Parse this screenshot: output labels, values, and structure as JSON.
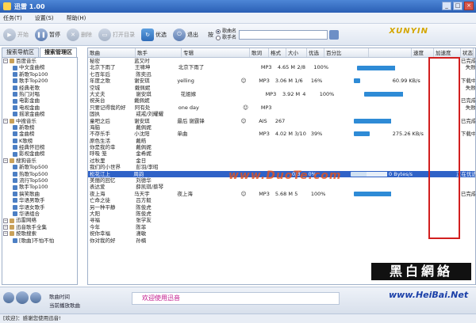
{
  "title_bar": {
    "title": "迅雷 1.00"
  },
  "menu": [
    "任务(T)",
    "设置(S)",
    "帮助(H)"
  ],
  "toolbar": {
    "buttons": [
      {
        "label": "开始",
        "enabled": false
      },
      {
        "label": "暂停",
        "enabled": true
      },
      {
        "label": "删除",
        "enabled": false
      },
      {
        "label": "打开目录",
        "enabled": false
      },
      {
        "label": "优选",
        "enabled": true
      },
      {
        "label": "退出",
        "enabled": true
      }
    ],
    "search_prefix": "按",
    "search_options": [
      "歌曲名",
      "歌手名"
    ],
    "search_value": "",
    "logo": "XUNYIN"
  },
  "tabs": [
    "搜索导航区",
    "搜索管理区"
  ],
  "tree": [
    {
      "label": "百度音乐",
      "level": 0
    },
    {
      "label": "中文金曲榜",
      "level": 1
    },
    {
      "label": "新歌Top100",
      "level": 1
    },
    {
      "label": "歌手Top200",
      "level": 1
    },
    {
      "label": "经典老歌",
      "level": 1
    },
    {
      "label": "热门对唱",
      "level": 1
    },
    {
      "label": "电影金曲",
      "level": 1
    },
    {
      "label": "电视金曲",
      "level": 1
    },
    {
      "label": "摇滚金曲榜",
      "level": 1
    },
    {
      "label": "中搜音乐",
      "level": 0
    },
    {
      "label": "新歌榜",
      "level": 1
    },
    {
      "label": "金曲榜",
      "level": 1
    },
    {
      "label": "K歌榜",
      "level": 1
    },
    {
      "label": "经典怀旧榜",
      "level": 1
    },
    {
      "label": "影视金曲榜",
      "level": 1
    },
    {
      "label": "搜狗音乐",
      "level": 0
    },
    {
      "label": "新歌Top500",
      "level": 1
    },
    {
      "label": "热歌Top500",
      "level": 1
    },
    {
      "label": "流行Top500",
      "level": 1
    },
    {
      "label": "歌手Top100",
      "level": 1
    },
    {
      "label": "搞笑歌曲",
      "level": 1
    },
    {
      "label": "华语男歌手",
      "level": 1
    },
    {
      "label": "华语女歌手",
      "level": 1
    },
    {
      "label": "华语组合",
      "level": 1
    },
    {
      "label": "迅雷网络",
      "level": 0
    },
    {
      "label": "迅音歌手全集",
      "level": 0
    },
    {
      "label": "按歌搜索",
      "level": 0
    },
    {
      "label": "[歌曲]不怕不怕",
      "level": 1
    }
  ],
  "list": {
    "columns": [
      "歌曲",
      "歌手",
      "专辑",
      "歌词",
      "格式",
      "大小",
      "优选",
      "百分比",
      "",
      "速度",
      "加速度",
      "状态"
    ],
    "rows": [
      {
        "song": "秘密",
        "artist": "蓝又时",
        "album": "",
        "lyric": "",
        "fmt": "",
        "size": "",
        "pick": "",
        "pct": "",
        "bar": 0,
        "speed": "",
        "accel": "",
        "status": "已完成"
      },
      {
        "song": "北京下雨了",
        "artist": "王啸坤",
        "album": "北京下雨了",
        "lyric": "",
        "fmt": "MP3",
        "size": "4.65 M",
        "pick": "2/8",
        "pct": "100%",
        "bar": 100,
        "speed": "",
        "accel": "",
        "status": "失败"
      },
      {
        "song": "七百年后",
        "artist": "陈奕迅",
        "album": "",
        "lyric": "",
        "fmt": "",
        "size": "",
        "pick": "",
        "pct": "",
        "bar": 0,
        "speed": "",
        "accel": "",
        "status": ""
      },
      {
        "song": "年度之歌",
        "artist": "谢安琪",
        "album": "yelling",
        "lyric": "☺",
        "fmt": "MP3",
        "size": "3.06 M",
        "pick": "1/6",
        "pct": "16%",
        "bar": 16,
        "speed": "60.99 KB/s",
        "accel": "",
        "status": "下载中"
      },
      {
        "song": "空城",
        "artist": "戴佩妮",
        "album": "",
        "lyric": "",
        "fmt": "",
        "size": "",
        "pick": "",
        "pct": "",
        "bar": 0,
        "speed": "",
        "accel": "",
        "status": "失败"
      },
      {
        "song": "大丈夫",
        "artist": "谢安琪",
        "album": "花姐嫁",
        "lyric": "",
        "fmt": "MP3",
        "size": "3.92 M",
        "pick": "4",
        "pct": "100%",
        "bar": 100,
        "speed": "",
        "accel": "",
        "status": ""
      },
      {
        "song": "祝英台",
        "artist": "戴佩妮",
        "album": "",
        "lyric": "",
        "fmt": "",
        "size": "",
        "pick": "",
        "pct": "",
        "bar": 0,
        "speed": "",
        "accel": "",
        "status": "已完成"
      },
      {
        "song": "只要记得我的好",
        "artist": "阿有处",
        "album": "one day",
        "lyric": "☺",
        "fmt": "MP3",
        "size": "",
        "pick": "",
        "pct": "",
        "bar": 0,
        "speed": "",
        "accel": "",
        "status": "失败"
      },
      {
        "song": "固执",
        "artist": "戒戒/刘耀耀",
        "album": "",
        "lyric": "",
        "fmt": "",
        "size": "",
        "pick": "",
        "pct": "",
        "bar": 0,
        "speed": "",
        "accel": "",
        "status": ""
      },
      {
        "song": "童吧之后",
        "artist": "谢安琪",
        "album": "最后 谢霆锋",
        "lyric": "☺",
        "fmt": "AIS",
        "size": "267",
        "pick": "",
        "pct": "",
        "bar": 100,
        "speed": "",
        "accel": "",
        "status": "已完成"
      },
      {
        "song": "海脑",
        "artist": "戴佩妮",
        "album": "",
        "lyric": "",
        "fmt": "",
        "size": "",
        "pick": "",
        "pct": "",
        "bar": 0,
        "speed": "",
        "accel": "",
        "status": ""
      },
      {
        "song": "不存乐手",
        "artist": "小沈阳",
        "album": "单曲",
        "lyric": "",
        "fmt": "MP3",
        "size": "4.02 M",
        "pick": "3/10",
        "pct": "39%",
        "bar": 39,
        "speed": "275.26 KB/s",
        "accel": "",
        "status": "下载中"
      },
      {
        "song": "原色生活",
        "artist": "戴皓",
        "album": "",
        "lyric": "",
        "fmt": "",
        "size": "",
        "pick": "",
        "pct": "",
        "bar": 0,
        "speed": "",
        "accel": "",
        "status": ""
      },
      {
        "song": "你是我的幸",
        "artist": "戴佩妮",
        "album": "",
        "lyric": "",
        "fmt": "",
        "size": "",
        "pick": "",
        "pct": "",
        "bar": 0,
        "speed": "",
        "accel": "",
        "status": ""
      },
      {
        "song": "呼吸 笼",
        "artist": "金希妮",
        "album": "",
        "lyric": "",
        "fmt": "",
        "size": "",
        "pick": "",
        "pct": "",
        "bar": 0,
        "speed": "",
        "accel": "",
        "status": ""
      },
      {
        "song": "过秋里",
        "artist": "金日",
        "album": "",
        "lyric": "",
        "fmt": "",
        "size": "",
        "pick": "",
        "pct": "",
        "bar": 0,
        "speed": "",
        "accel": "",
        "status": ""
      },
      {
        "song": "我们的小世界",
        "artist": "彭羽/李昭",
        "album": "",
        "lyric": "",
        "fmt": "",
        "size": "",
        "pick": "",
        "pct": "",
        "bar": 0,
        "speed": "",
        "accel": "",
        "status": ""
      },
      {
        "song": "松花江上",
        "artist": "周韵",
        "album": "",
        "lyric": "",
        "fmt": "",
        "size": "",
        "pick": "0/3",
        "pct": "0%",
        "bar": 0,
        "speed": "0 Bytes/s",
        "accel": "",
        "status": "正在优选",
        "selected": true
      },
      {
        "song": "美丽的回忆",
        "artist": "刘德华",
        "album": "",
        "lyric": "",
        "fmt": "",
        "size": "",
        "pick": "",
        "pct": "",
        "bar": 0,
        "speed": "",
        "accel": "",
        "status": ""
      },
      {
        "song": "表达爱",
        "artist": "薛凯琪/蔡琴",
        "album": "",
        "lyric": "",
        "fmt": "",
        "size": "",
        "pick": "",
        "pct": "",
        "bar": 0,
        "speed": "",
        "accel": "",
        "status": ""
      },
      {
        "song": "夜上海",
        "artist": "马天宇",
        "album": "夜上海",
        "lyric": "☺",
        "fmt": "MP3",
        "size": "5.68 M",
        "pick": "5",
        "pct": "100%",
        "bar": 100,
        "speed": "",
        "accel": "",
        "status": "已完成"
      },
      {
        "song": "亡命之徒",
        "artist": "吕方毅",
        "album": "",
        "lyric": "",
        "fmt": "",
        "size": "",
        "pick": "",
        "pct": "",
        "bar": 0,
        "speed": "",
        "accel": "",
        "status": ""
      },
      {
        "song": "另一种平静",
        "artist": "陈俊虎",
        "album": "",
        "lyric": "",
        "fmt": "",
        "size": "",
        "pick": "",
        "pct": "",
        "bar": 0,
        "speed": "",
        "accel": "",
        "status": ""
      },
      {
        "song": "大阳",
        "artist": "陈俊虎",
        "album": "",
        "lyric": "",
        "fmt": "",
        "size": "",
        "pick": "",
        "pct": "",
        "bar": 0,
        "speed": "",
        "accel": "",
        "status": ""
      },
      {
        "song": "寻福",
        "artist": "张学友",
        "album": "",
        "lyric": "",
        "fmt": "",
        "size": "",
        "pick": "",
        "pct": "",
        "bar": 0,
        "speed": "",
        "accel": "",
        "status": ""
      },
      {
        "song": "今年",
        "artist": "陈菲",
        "album": "",
        "lyric": "",
        "fmt": "",
        "size": "",
        "pick": "",
        "pct": "",
        "bar": 0,
        "speed": "",
        "accel": "",
        "status": ""
      },
      {
        "song": "祝你幸福",
        "artist": "潇敏",
        "album": "",
        "lyric": "",
        "fmt": "",
        "size": "",
        "pick": "",
        "pct": "",
        "bar": 0,
        "speed": "",
        "accel": "",
        "status": ""
      },
      {
        "song": "你对我的好",
        "artist": "孙楠",
        "album": "",
        "lyric": "",
        "fmt": "",
        "size": "",
        "pick": "",
        "pct": "",
        "bar": 0,
        "speed": "",
        "accel": "",
        "status": ""
      }
    ]
  },
  "player": {
    "time_label": "歌曲时间",
    "now_playing_label": "当前播放歌曲"
  },
  "marquee": "欢迎使用迅音",
  "status_bar": "[欢迎]：感谢您使用迅音!",
  "watermarks": {
    "duote": "www.DuoTe.com",
    "heibai_cn": "黑白網絡",
    "heibai_url": "www.HeiBai.Net"
  },
  "colors": {
    "selection": "#2f62c7",
    "progress": "#2e8bd6",
    "highlight_box": "#d21f1f",
    "marquee_text": "#c0178b"
  }
}
